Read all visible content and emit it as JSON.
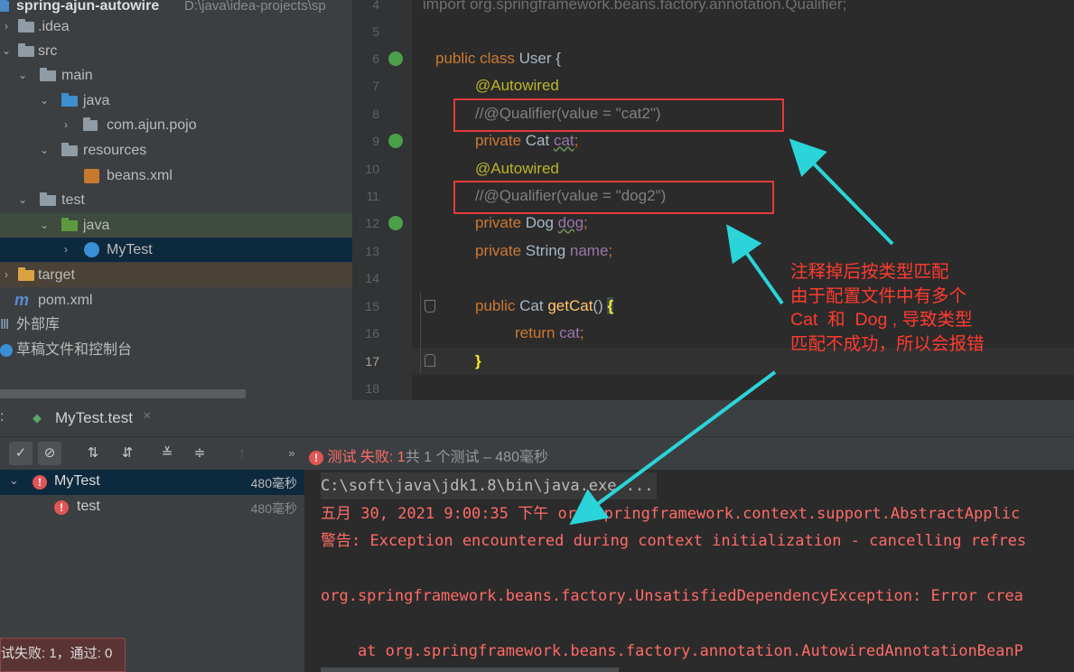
{
  "project": {
    "name": "spring-ajun-autowire",
    "path": "D:\\java\\idea-projects\\sp",
    "tree": [
      {
        "label": ".idea",
        "indent": 0
      },
      {
        "label": "src",
        "indent": 0
      },
      {
        "label": "main",
        "indent": 1
      },
      {
        "label": "java",
        "indent": 2
      },
      {
        "label": "com.ajun.pojo",
        "indent": 3
      },
      {
        "label": "resources",
        "indent": 2
      },
      {
        "label": "beans.xml",
        "indent": 3
      },
      {
        "label": "test",
        "indent": 1
      },
      {
        "label": "java",
        "indent": 2
      },
      {
        "label": "MyTest",
        "indent": 3
      },
      {
        "label": "target",
        "indent": 0
      },
      {
        "label": "pom.xml",
        "indent": 0
      },
      {
        "label": "外部库",
        "indent": 0
      },
      {
        "label": "草稿文件和控制台",
        "indent": 0
      }
    ]
  },
  "editor": {
    "line_numbers": [
      "4",
      "5",
      "6",
      "7",
      "8",
      "9",
      "10",
      "11",
      "12",
      "13",
      "14",
      "15",
      "16",
      "17",
      "18"
    ],
    "current_line": "17",
    "top_line": "import org.springframework.beans.factory.annotation.Qualifier;",
    "code": {
      "l6a": "public class ",
      "l6b": "User {",
      "l7": "@Autowired",
      "l8": "//@Qualifier(value = \"cat2\")",
      "l9a": "private ",
      "l9b": "Cat ",
      "l9c": "cat",
      "l9d": ";",
      "l10": "@Autowired",
      "l11": "//@Qualifier(value = \"dog2\")",
      "l12a": "private ",
      "l12b": "Dog ",
      "l12c": "dog",
      "l12d": ";",
      "l13a": "private ",
      "l13b": "String ",
      "l13c": "name",
      "l13d": ";",
      "l15a": "public ",
      "l15b": "Cat ",
      "l15c": "getCat",
      "l15d": "() ",
      "l15e": "{",
      "l16a": "return ",
      "l16b": "cat",
      "l16c": ";",
      "l17": "}"
    }
  },
  "note": {
    "text": "注释掉后按类型匹配\n由于配置文件中有多个\nCat  和  Dog , 导致类型\n匹配不成功，所以会报错"
  },
  "run": {
    "tab_prefix": ":",
    "tab_label": "MyTest.test",
    "status_prefix": "测试 失败: ",
    "status_count": "1",
    "status_suffix": "共 1 个测试 – 480毫秒",
    "tree": [
      {
        "label": "MyTest",
        "time": "480毫秒"
      },
      {
        "label": "test",
        "time": "480毫秒"
      }
    ],
    "summary": "试失败: 1，通过: 0"
  },
  "console": {
    "lines": [
      "C:\\soft\\java\\jdk1.8\\bin\\java.exe ...",
      "五月 30, 2021 9:00:35 下午 org.springframework.context.support.AbstractApplic",
      "警告: Exception encountered during context initialization - cancelling refres",
      "",
      "org.springframework.beans.factory.UnsatisfiedDependencyException: Error crea",
      "",
      "    at org.springframework.beans.factory.annotation.AutowiredAnnotationBeanP"
    ]
  },
  "colors": {
    "accent_red": "#e63a3a",
    "arrow_cyan": "#2ad4d9",
    "note_red": "#ff3b30"
  }
}
